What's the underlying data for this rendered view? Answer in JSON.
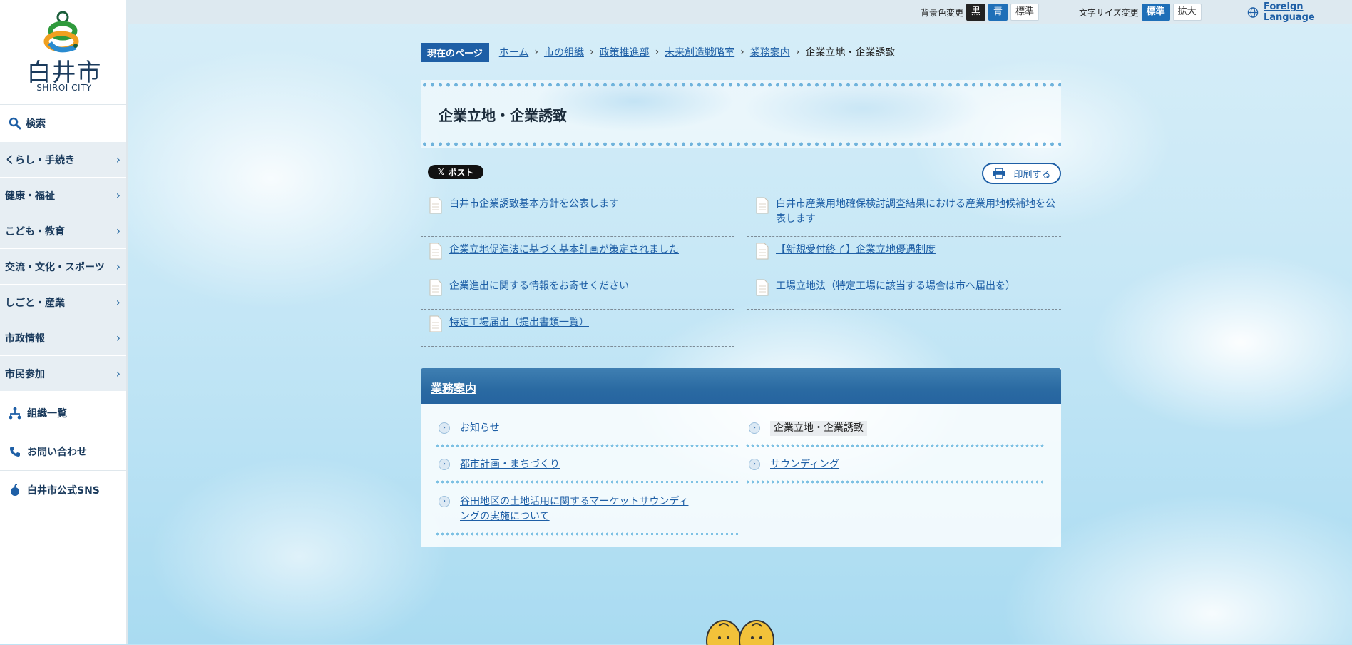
{
  "logo": {
    "text": "白井市",
    "subtext": "SHIROI CITY"
  },
  "sidebar": {
    "search_label": "検索",
    "menu": [
      {
        "label": "くらし・手続き"
      },
      {
        "label": "健康・福祉"
      },
      {
        "label": "こども・教育"
      },
      {
        "label": "交流・文化・スポーツ"
      },
      {
        "label": "しごと・産業"
      },
      {
        "label": "市政情報"
      },
      {
        "label": "市民参加"
      }
    ],
    "links": [
      {
        "label": "組織一覧",
        "icon": "org-chart-icon"
      },
      {
        "label": "お問い合わせ",
        "icon": "phone-icon"
      },
      {
        "label": "白井市公式SNS",
        "icon": "pear-icon"
      }
    ]
  },
  "topbar": {
    "bg_label": "背景色変更",
    "bg_options": [
      "黒",
      "青",
      "標準"
    ],
    "size_label": "文字サイズ変更",
    "size_options": [
      "標準",
      "拡大"
    ],
    "foreign": "Foreign Language"
  },
  "breadcrumb": {
    "label": "現在のページ",
    "items": [
      "ホーム",
      "市の組織",
      "政策推進部",
      "未来創造戦略室",
      "業務案内"
    ],
    "current": "企業立地・企業誘致"
  },
  "page": {
    "title": "企業立地・企業誘致",
    "x_post": "ポスト",
    "print": "印刷する"
  },
  "docs": [
    "白井市企業誘致基本方針を公表します",
    "白井市産業用地確保検討調査結果における産業用地候補地を公表します",
    "企業立地促進法に基づく基本計画が策定されました",
    "【新規受付終了】企業立地優遇制度",
    "企業進出に関する情報をお寄せください",
    "工場立地法（特定工場に該当する場合は市へ届出を）",
    "特定工場届出（提出書類一覧）"
  ],
  "section": {
    "title": "業務案内",
    "items": [
      "お知らせ",
      "企業立地・企業誘致",
      "都市計画・まちづくり",
      "サウンディング",
      "谷田地区の土地活用に関するマーケットサウンディングの実施について"
    ]
  },
  "colors": {
    "brand_blue": "#1e5fa6",
    "header_blue": "#2a6aa2",
    "sidebar_bg": "#e7eef3"
  }
}
